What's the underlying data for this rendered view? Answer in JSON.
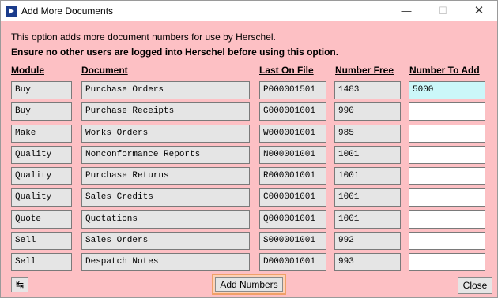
{
  "window": {
    "title": "Add More Documents"
  },
  "info": {
    "line1": "This option adds more document numbers for use by Herschel.",
    "line2": "Ensure no other users are logged into Herschel before using this option."
  },
  "headers": {
    "module": "Module",
    "document": "Document",
    "last_on_file": "Last On File",
    "number_free": "Number Free",
    "number_to_add": "Number To Add"
  },
  "rows": [
    {
      "module": "Buy",
      "document": "Purchase Orders",
      "last_on_file": "P000001501",
      "number_free": "1483",
      "number_to_add": "5000"
    },
    {
      "module": "Buy",
      "document": "Purchase Receipts",
      "last_on_file": "G000001001",
      "number_free": "990",
      "number_to_add": ""
    },
    {
      "module": "Make",
      "document": "Works Orders",
      "last_on_file": "W000001001",
      "number_free": "985",
      "number_to_add": ""
    },
    {
      "module": "Quality",
      "document": "Nonconformance Reports",
      "last_on_file": "N000001001",
      "number_free": "1001",
      "number_to_add": ""
    },
    {
      "module": "Quality",
      "document": "Purchase Returns",
      "last_on_file": "R000001001",
      "number_free": "1001",
      "number_to_add": ""
    },
    {
      "module": "Quality",
      "document": "Sales Credits",
      "last_on_file": "C000001001",
      "number_free": "1001",
      "number_to_add": ""
    },
    {
      "module": "Quote",
      "document": "Quotations",
      "last_on_file": "Q000001001",
      "number_free": "1001",
      "number_to_add": ""
    },
    {
      "module": "Sell",
      "document": "Sales Orders",
      "last_on_file": "S000001001",
      "number_free": "992",
      "number_to_add": ""
    },
    {
      "module": "Sell",
      "document": "Despatch Notes",
      "last_on_file": "D000001001",
      "number_free": "993",
      "number_to_add": ""
    }
  ],
  "buttons": {
    "add_numbers": "Add Numbers",
    "close": "Close",
    "pin_icon": "pin-icon"
  },
  "colors": {
    "background": "#fdc0c4",
    "active_input": "#cbf7f9",
    "title_icon": "#1b3c8c"
  }
}
